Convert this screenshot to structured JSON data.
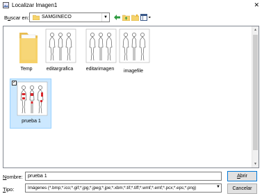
{
  "window": {
    "title": "Localizar Imagen1"
  },
  "lookin": {
    "label_prefix": "B",
    "label_underlined": "u",
    "label_rest": "scar en:",
    "value": "SAMGINECO"
  },
  "toolbar": {
    "icons": [
      "back-icon",
      "up-folder-icon",
      "new-folder-icon",
      "view-menu-icon"
    ]
  },
  "files": [
    {
      "name": "Temp",
      "type": "folder"
    },
    {
      "name": "editargrafica",
      "type": "image"
    },
    {
      "name": "editarimagen",
      "type": "image"
    },
    {
      "name": "imagefile",
      "type": "image"
    },
    {
      "name": "prueba 1",
      "type": "image",
      "selected": true
    }
  ],
  "name_field": {
    "label_underlined": "N",
    "label_rest": "ombre:",
    "value": "prueba 1"
  },
  "type_field": {
    "label_underlined": "T",
    "label_rest": "ipo:",
    "value": "Imágenes (*.bmp;*.ico;*.gif;*.jpg;*.jpeg;*.jpe;*.xbm;*.tif;*.tiff;*.wmf;*.emf;*.pcx;*.eps;*.png)"
  },
  "buttons": {
    "open_underlined": "A",
    "open_rest": "brir",
    "cancel": "Cancelar"
  },
  "colors": {
    "selection": "#cce8ff",
    "folder": "#f6d36b",
    "accent": "#0078d7"
  }
}
